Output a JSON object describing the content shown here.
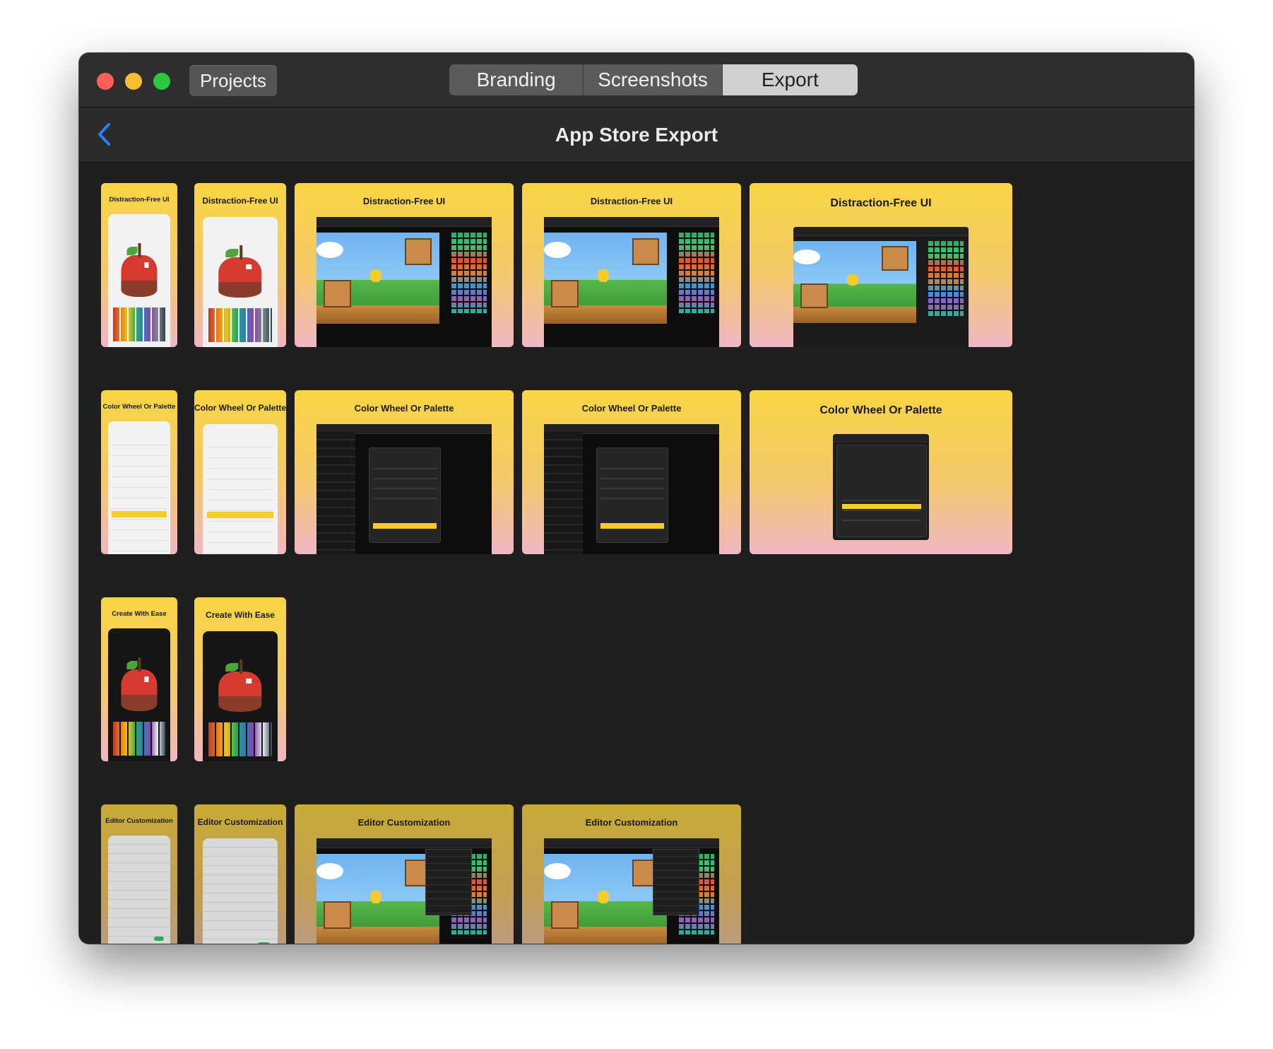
{
  "window": {
    "projects_label": "Projects",
    "tabs": [
      {
        "label": "Branding",
        "selected": false
      },
      {
        "label": "Screenshots",
        "selected": false
      },
      {
        "label": "Export",
        "selected": true
      }
    ]
  },
  "nav": {
    "title": "App Store Export",
    "back_icon": "chevron-left-icon"
  },
  "colors": {
    "accent_blue": "#2f7cf6",
    "card_gradient_top": "#f8d543",
    "card_gradient_bottom": "#f0b6c4",
    "window_bg": "#1f1f1f"
  },
  "groups": [
    {
      "title": "Distraction-Free UI",
      "cards": [
        {
          "title": "Distraction-Free UI",
          "device": "iPhone (small)"
        },
        {
          "title": "Distraction-Free UI",
          "device": "iPhone (large)"
        },
        {
          "title": "Distraction-Free UI",
          "device": "iPad"
        },
        {
          "title": "Distraction-Free UI",
          "device": "iPad Pro"
        },
        {
          "title": "Distraction-Free UI",
          "device": "Mac"
        }
      ]
    },
    {
      "title": "Color Wheel Or Palette",
      "cards": [
        {
          "title": "Color Wheel Or Palette",
          "device": "iPhone (small)"
        },
        {
          "title": "Color Wheel Or Palette",
          "device": "iPhone (large)"
        },
        {
          "title": "Color Wheel Or Palette",
          "device": "iPad"
        },
        {
          "title": "Color Wheel Or Palette",
          "device": "iPad Pro"
        },
        {
          "title": "Color Wheel Or Palette",
          "device": "Mac"
        }
      ]
    },
    {
      "title": "Create With Ease",
      "cards": [
        {
          "title": "Create With Ease",
          "device": "iPhone (small)"
        },
        {
          "title": "Create With Ease",
          "device": "iPhone (large)"
        }
      ]
    },
    {
      "title": "Editor Customization",
      "cards": [
        {
          "title": "Editor Customization",
          "device": "iPhone (small)"
        },
        {
          "title": "Editor Customization",
          "device": "iPhone (large)"
        },
        {
          "title": "Editor Customization",
          "device": "iPad"
        },
        {
          "title": "Editor Customization",
          "device": "iPad Pro"
        }
      ]
    }
  ]
}
